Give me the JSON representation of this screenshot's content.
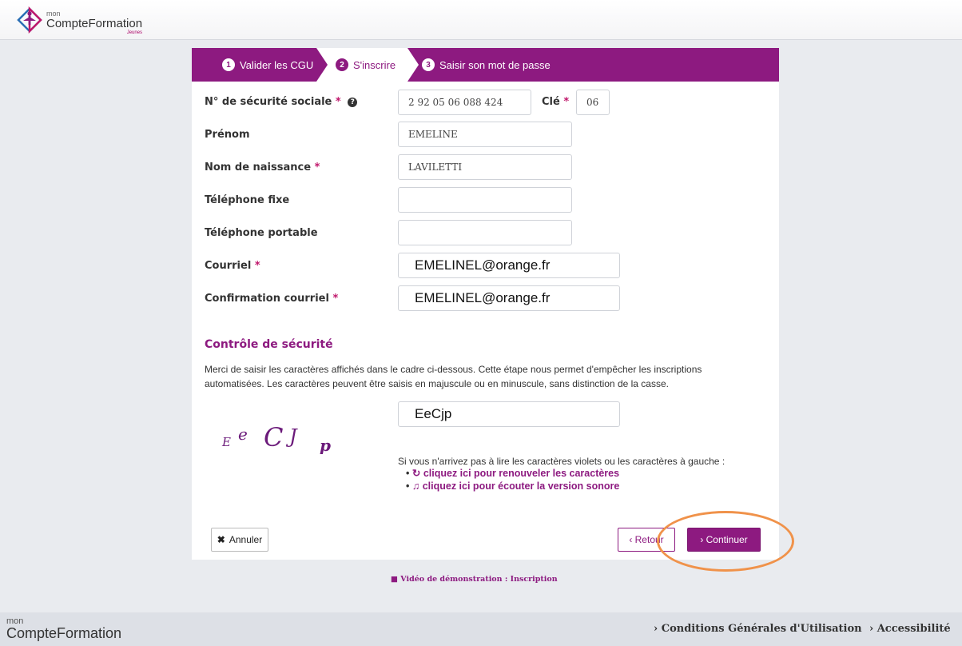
{
  "header": {
    "logo_mon": "mon",
    "logo_name": "CompteFormation",
    "logo_sub": "Jeunes"
  },
  "steps": [
    {
      "num": "1",
      "label": "Valider les CGU"
    },
    {
      "num": "2",
      "label": "S'inscrire"
    },
    {
      "num": "3",
      "label": "Saisir son mot de passe"
    }
  ],
  "form": {
    "ssn_label": "N° de sécurité sociale",
    "ssn_value": "2 92 05 06 088 424",
    "cle_label": "Clé",
    "cle_value": "06",
    "prenom_label": "Prénom",
    "prenom_value": "EMELINE",
    "nom_label": "Nom de naissance",
    "nom_value": "LAVILETTI",
    "tel_fixe_label": "Téléphone fixe",
    "tel_fixe_value": "",
    "tel_port_label": "Téléphone portable",
    "tel_port_value": "",
    "courriel_label": "Courriel",
    "courriel_value": "EMELINEL@orange.fr",
    "conf_label": "Confirmation courriel",
    "conf_value": "EMELINEL@orange.fr",
    "required_mark": "*",
    "help_mark": "?"
  },
  "security": {
    "title": "Contrôle de sécurité",
    "text": "Merci de saisir les caractères affichés dans le cadre ci-dessous. Cette étape nous permet d'empêcher les inscriptions automatisées. Les caractères peuvent être saisis en majuscule ou en minuscule, sans distinction de la casse.",
    "captcha_chars": [
      "E",
      "e",
      "C",
      "J",
      "p"
    ],
    "captcha_value": "EeCjp",
    "cannot_read": "Si vous n'arrivez pas à lire les caractères violets ou les caractères à gauche :",
    "renew_link": "cliquez ici pour renouveler les caractères",
    "audio_link": "cliquez ici pour écouter la version sonore"
  },
  "buttons": {
    "cancel": "Annuler",
    "back": "‹ Retour",
    "continue": "› Continuer"
  },
  "video_link": "Vidéo de démonstration : Inscription",
  "footer": {
    "logo_mon": "mon",
    "logo_name": "CompteFormation",
    "cgu_link": "› Conditions Générales d'Utilisation",
    "access_link": "› Accessibilité"
  },
  "colors": {
    "brand_purple": "#8d1a80",
    "highlight_orange": "#f0924a",
    "page_bg": "#e9ebef"
  }
}
